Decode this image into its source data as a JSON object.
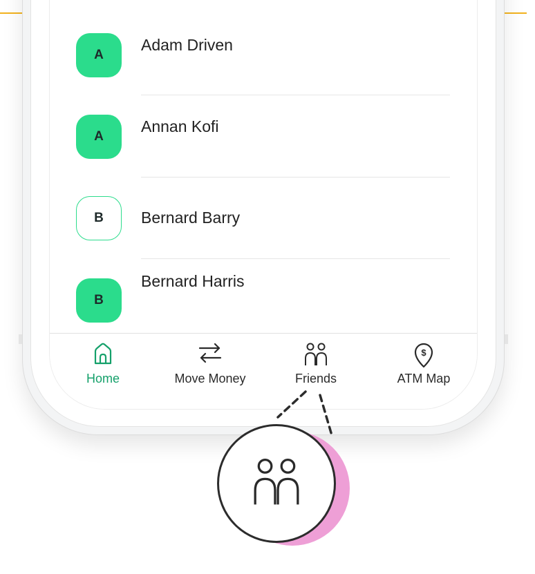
{
  "contacts": [
    {
      "initial": "A",
      "name": "Adam Driven",
      "avatar_style": "filled"
    },
    {
      "initial": "A",
      "name": "Annan Kofi",
      "avatar_style": "filled"
    },
    {
      "initial": "B",
      "name": "Bernard Barry",
      "avatar_style": "outline"
    },
    {
      "initial": "B",
      "name": "Bernard Harris",
      "avatar_style": "filled"
    }
  ],
  "tabbar": {
    "tabs": [
      {
        "label": "Home",
        "icon": "home-icon",
        "active": true
      },
      {
        "label": "Move Money",
        "icon": "transfer-arrows-icon",
        "active": false
      },
      {
        "label": "Friends",
        "icon": "friends-icon",
        "active": false
      },
      {
        "label": "ATM Map",
        "icon": "atm-pin-icon",
        "active": false
      }
    ]
  },
  "callout": {
    "icon": "friends-icon"
  },
  "colors": {
    "accent_green": "#2bdc8c",
    "active_tab_text": "#14a06a",
    "callout_shadow": "#ee9fd6",
    "top_rule": "#f2b21d"
  }
}
